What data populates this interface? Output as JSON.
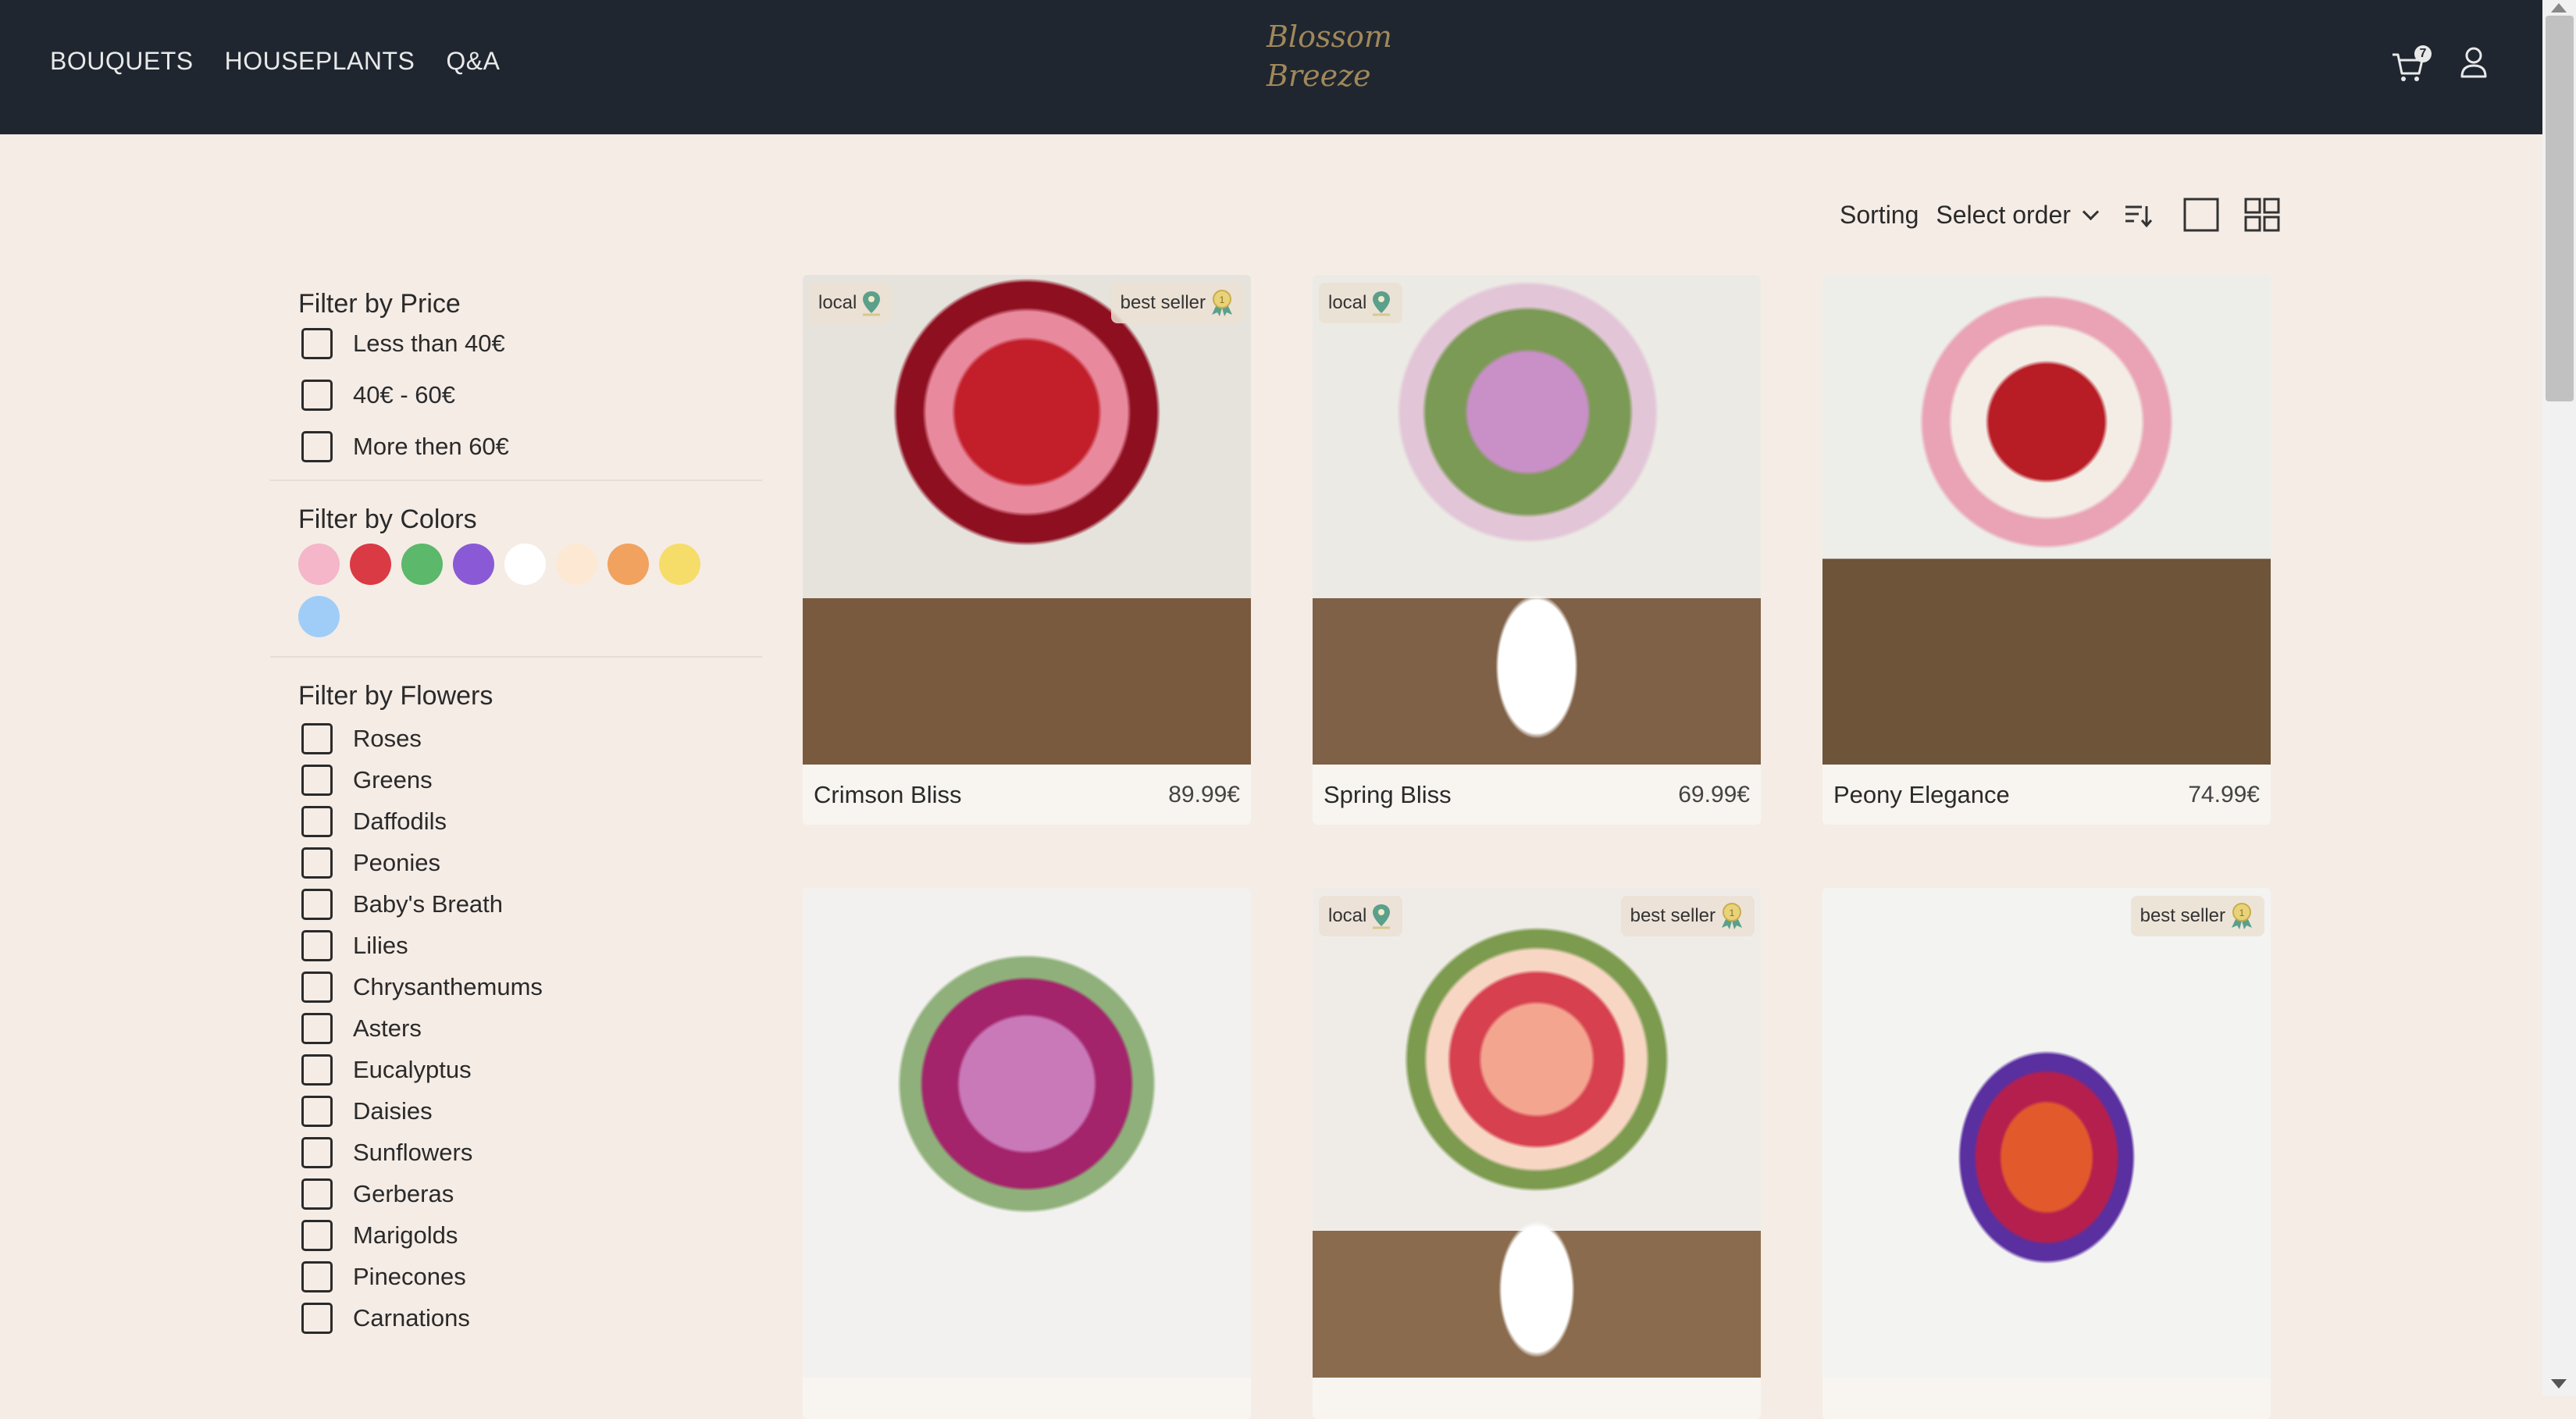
{
  "header": {
    "nav": [
      "BOUQUETS",
      "HOUSEPLANTS",
      "Q&A"
    ],
    "logo_line1": "Blossom",
    "logo_line2": "Breeze",
    "cart_count": "7",
    "cart_icon": "cart-icon",
    "user_icon": "user-icon"
  },
  "toolbar": {
    "sorting_label": "Sorting",
    "select_value": "Select order"
  },
  "filters": {
    "price": {
      "title": "Filter by Price",
      "options": [
        "Less than 40€",
        "40€ - 60€",
        "More then 60€"
      ]
    },
    "colors": {
      "title": "Filter by Colors",
      "swatches": [
        "#f4b6c8",
        "#d93a44",
        "#5cb86a",
        "#8a5ad6",
        "#ffffff",
        "#fde9d3",
        "#f0a25e",
        "#f6dd6a",
        "#9fcdf7"
      ]
    },
    "flowers": {
      "title": "Filter by Flowers",
      "options": [
        "Roses",
        "Greens",
        "Daffodils",
        "Peonies",
        "Baby's Breath",
        "Lilies",
        "Chrysanthemums",
        "Asters",
        "Eucalyptus",
        "Daisies",
        "Sunflowers",
        "Gerberas",
        "Marigolds",
        "Pinecones",
        "Carnations"
      ]
    }
  },
  "products": [
    {
      "name": "Crimson Bliss",
      "price": "89.99€",
      "local": "local",
      "best": "best seller"
    },
    {
      "name": "Spring Bliss",
      "price": "69.99€",
      "local": "local",
      "best": ""
    },
    {
      "name": "Peony Elegance",
      "price": "74.99€",
      "local": "",
      "best": ""
    },
    {
      "name": "",
      "price": "",
      "local": "",
      "best": ""
    },
    {
      "name": "",
      "price": "",
      "local": "local",
      "best": "best seller"
    },
    {
      "name": "",
      "price": "",
      "local": "",
      "best": "best seller"
    }
  ],
  "colors": {
    "header_bg": "#1f2630",
    "page_bg": "#f5ece6",
    "logo": "#a1885a"
  }
}
